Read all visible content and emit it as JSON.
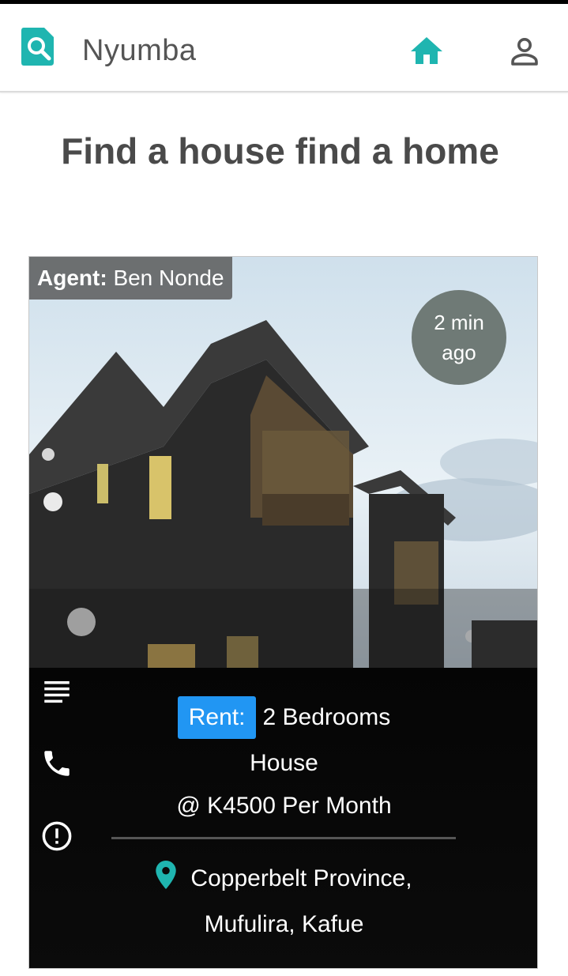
{
  "app": {
    "name": "Nyumba",
    "accent": "#1fb5b0"
  },
  "header": {
    "home_icon": "home-icon",
    "account_icon": "person-icon"
  },
  "headline": "Find a house find a home",
  "listing": {
    "agent_label": "Agent:",
    "agent_name": "Ben Nonde",
    "time_line1": "2 min",
    "time_line2": "ago",
    "rent_label": "Rent:",
    "title_line1": "2 Bedrooms",
    "title_line2": "House",
    "price": "@ K4500 Per Month",
    "location_line1": "Copperbelt Province,",
    "location_line2": "Mufulira, Kafue",
    "side_icons": [
      "details-icon",
      "phone-icon",
      "report-icon"
    ],
    "rent_color": "#2196f3"
  }
}
